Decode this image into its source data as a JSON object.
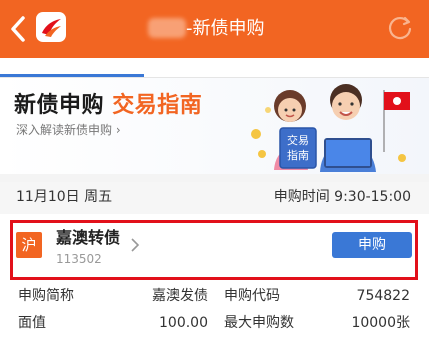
{
  "header": {
    "title": "-新债申购",
    "back_icon": "chevron-left-icon",
    "refresh_icon": "refresh-icon",
    "bg_color": "#f26522"
  },
  "banner": {
    "title_main": "新债申购",
    "title_accent": "交易指南",
    "subtitle": "深入解读新债申购",
    "illustration_text": [
      "交易",
      "指南"
    ]
  },
  "date_row": {
    "date": "11月10日 周五",
    "time_label": "申购时间",
    "time_value": "9:30-15:00"
  },
  "bond": {
    "market": "沪",
    "name": "嘉澳转债",
    "code": "113502",
    "action": "申购"
  },
  "info": {
    "short_name_label": "申购简称",
    "short_name_value": "嘉澳发债",
    "code_label": "申购代码",
    "code_value": "754822",
    "par_label": "面值",
    "par_value": "100.00",
    "max_label": "最大申购数",
    "max_value": "10000张"
  }
}
